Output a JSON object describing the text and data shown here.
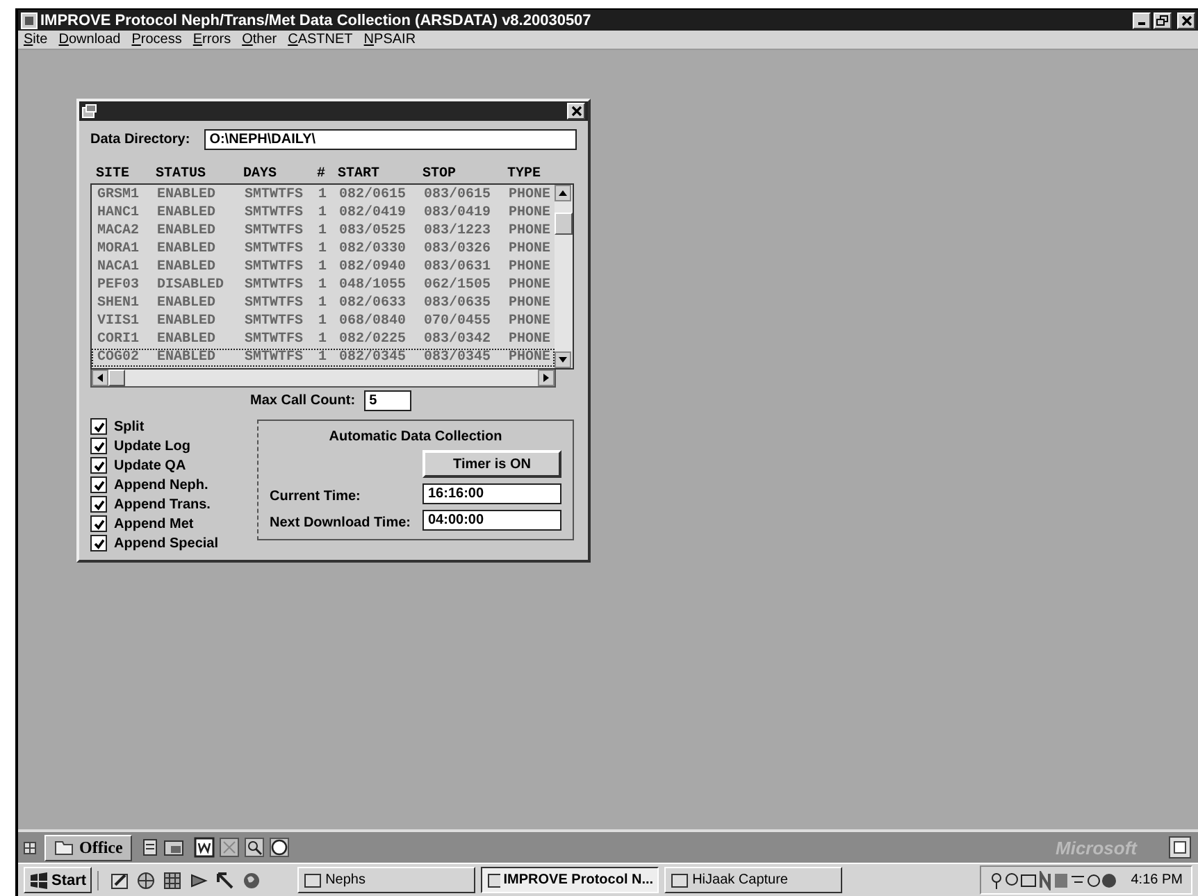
{
  "window": {
    "title": "IMPROVE Protocol Neph/Trans/Met Data Collection (ARSDATA) v8.20030507"
  },
  "menu": [
    "Site",
    "Download",
    "Process",
    "Errors",
    "Other",
    "CASTNET",
    "NPSAIR"
  ],
  "dialog": {
    "directory_label": "Data Directory:",
    "directory": "O:\\NEPH\\DAILY\\",
    "columns": [
      "SITE",
      "STATUS",
      "DAYS",
      "#",
      "START",
      "STOP",
      "TYPE"
    ],
    "rows": [
      {
        "cells": [
          "GRSM1",
          "ENABLED",
          "SMTWTFS",
          "1",
          "082/0615",
          "083/0615",
          "PHONE"
        ],
        "selected": false
      },
      {
        "cells": [
          "HANC1",
          "ENABLED",
          "SMTWTFS",
          "1",
          "082/0419",
          "083/0419",
          "PHONE"
        ],
        "selected": false
      },
      {
        "cells": [
          "MACA2",
          "ENABLED",
          "SMTWTFS",
          "1",
          "083/0525",
          "083/1223",
          "PHONE"
        ],
        "selected": false
      },
      {
        "cells": [
          "MORA1",
          "ENABLED",
          "SMTWTFS",
          "1",
          "082/0330",
          "083/0326",
          "PHONE"
        ],
        "selected": false
      },
      {
        "cells": [
          "NACA1",
          "ENABLED",
          "SMTWTFS",
          "1",
          "082/0940",
          "083/0631",
          "PHONE"
        ],
        "selected": false
      },
      {
        "cells": [
          "PEF03",
          "DISABLED",
          "SMTWTFS",
          "1",
          "048/1055",
          "062/1505",
          "PHONE"
        ],
        "selected": false
      },
      {
        "cells": [
          "SHEN1",
          "ENABLED",
          "SMTWTFS",
          "1",
          "082/0633",
          "083/0635",
          "PHONE"
        ],
        "selected": false
      },
      {
        "cells": [
          "VIIS1",
          "ENABLED",
          "SMTWTFS",
          "1",
          "068/0840",
          "070/0455",
          "PHONE"
        ],
        "selected": false
      },
      {
        "cells": [
          "CORI1",
          "ENABLED",
          "SMTWTFS",
          "1",
          "082/0225",
          "083/0342",
          "PHONE"
        ],
        "selected": false
      },
      {
        "cells": [
          "COG02",
          "ENABLED",
          "SMTWTFS",
          "1",
          "082/0345",
          "083/0345",
          "PHONE"
        ],
        "selected": true
      }
    ],
    "max_call_label": "Max Call Count:",
    "max_call": "5",
    "options": [
      {
        "label": "Split",
        "checked": true
      },
      {
        "label": "Update Log",
        "checked": true
      },
      {
        "label": "Update QA",
        "checked": true
      },
      {
        "label": "Append Neph.",
        "checked": true
      },
      {
        "label": "Append Trans.",
        "checked": true
      },
      {
        "label": "Append Met",
        "checked": true
      },
      {
        "label": "Append Special",
        "checked": true
      }
    ],
    "auto_title": "Automatic Data Collection",
    "timer_button": "Timer is ON",
    "current_time_label": "Current Time:",
    "current_time": "16:16:00",
    "next_time_label": "Next Download Time:",
    "next_time": "04:00:00"
  },
  "office_bar": {
    "label": "Office",
    "brand": "Microsoft"
  },
  "taskbar": {
    "start": "Start",
    "tasks": [
      {
        "label": "Nephs",
        "selected": false
      },
      {
        "label": "IMPROVE Protocol N...",
        "selected": true
      },
      {
        "label": "HiJaak Capture",
        "selected": false
      }
    ],
    "clock": "4:16 PM"
  }
}
